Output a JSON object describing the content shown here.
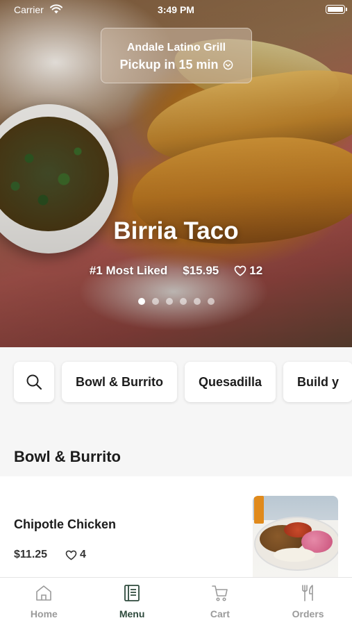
{
  "status_bar": {
    "carrier": "Carrier",
    "time": "3:49 PM"
  },
  "store": {
    "name": "Andale Latino Grill",
    "pickup": "Pickup in 15 min"
  },
  "featured": {
    "title": "Birria Taco",
    "badge": "#1 Most Liked",
    "price": "$15.95",
    "likes": "12",
    "slide_count": 6,
    "active_slide": 1
  },
  "categories": [
    {
      "label": "Bowl & Burrito"
    },
    {
      "label": "Quesadilla"
    },
    {
      "label": "Build y"
    }
  ],
  "section": {
    "title": "Bowl & Burrito"
  },
  "items": [
    {
      "name": "Chipotle Chicken",
      "price": "$11.25",
      "likes": "4"
    }
  ],
  "tabs": [
    {
      "label": "Home",
      "icon": "home-icon",
      "active": false
    },
    {
      "label": "Menu",
      "icon": "menu-icon",
      "active": true
    },
    {
      "label": "Cart",
      "icon": "cart-icon",
      "active": false
    },
    {
      "label": "Orders",
      "icon": "orders-icon",
      "active": false
    }
  ],
  "colors": {
    "active_tab": "#2e4a3c",
    "inactive_tab": "#9a9a9a"
  }
}
